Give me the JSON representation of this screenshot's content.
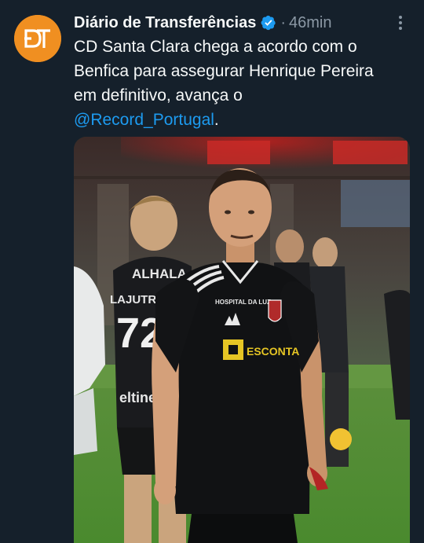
{
  "author": {
    "name": "Diário de Transferências",
    "avatar_text": "DT",
    "verified": true,
    "verified_icon": "verified-badge-icon",
    "time_separator": "·",
    "time": "46min"
  },
  "more_icon": "more-options-icon",
  "tweet": {
    "line1": "CD Santa Clara chega a acordo com o",
    "line2": "Benfica para assegurar Henrique Pereira",
    "line3": "em definitivo, avança o",
    "mention": "@Record_Portugal",
    "after_mention": "."
  },
  "media": {
    "type": "photo",
    "jersey": {
      "sponsor_1": "HOSPITAL DA LUZ",
      "sponsor_2": "ESCONTA",
      "teammate_name": "LAJUTRABAL",
      "teammate_number": "72",
      "teammate_sponsor": "ALHALA",
      "teammate_sponsor_2": "eltine"
    }
  },
  "colors": {
    "background": "#15202b",
    "text": "#f7f9f9",
    "muted": "#8b98a5",
    "link": "#1d9bf0",
    "avatar": "#f08f21"
  }
}
